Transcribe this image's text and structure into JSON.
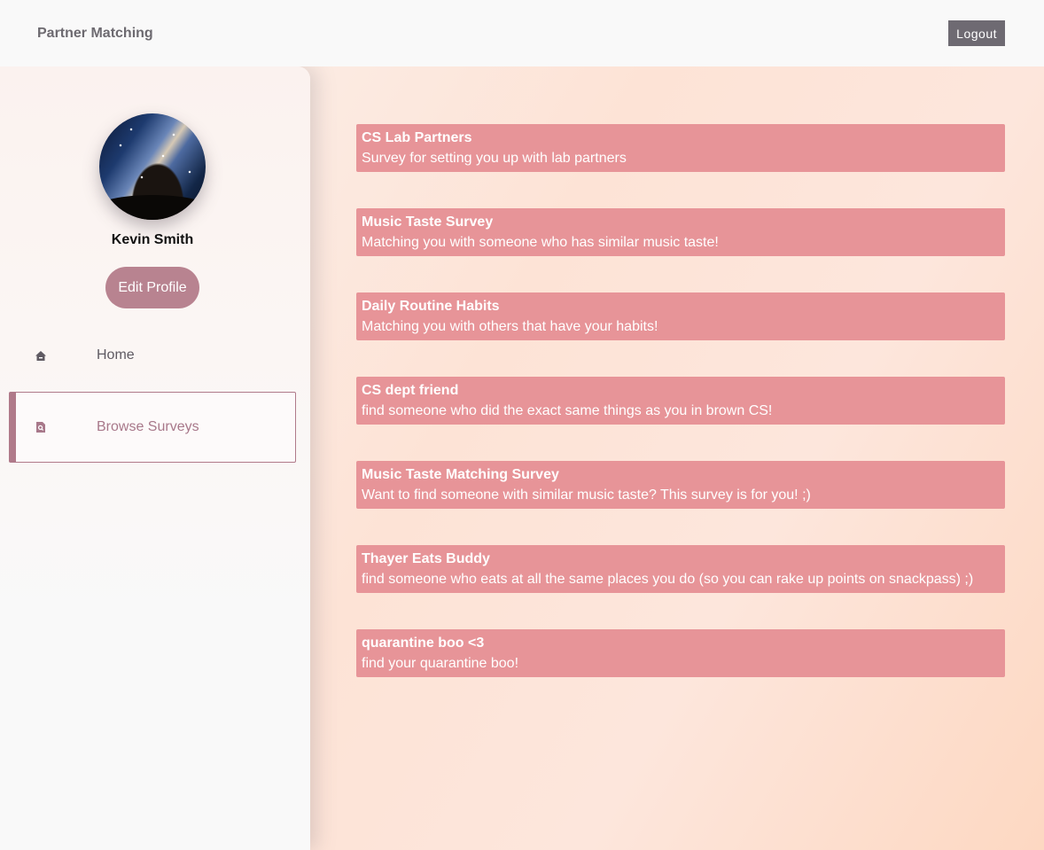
{
  "navbar": {
    "brand": "Partner Matching",
    "logout_label": "Logout"
  },
  "sidebar": {
    "user_name": "Kevin Smith",
    "edit_profile_label": "Edit Profile",
    "items": [
      {
        "label": "Home",
        "icon": "home-icon",
        "active": false
      },
      {
        "label": "Browse Surveys",
        "icon": "search-document-icon",
        "active": true
      }
    ]
  },
  "surveys": [
    {
      "title": "CS Lab Partners",
      "description": "Survey for setting you up with lab partners"
    },
    {
      "title": "Music Taste Survey",
      "description": "Matching you with someone who has similar music taste!"
    },
    {
      "title": "Daily Routine Habits",
      "description": "Matching you with others that have your habits!"
    },
    {
      "title": "CS dept friend",
      "description": "find someone who did the exact same things as you in brown CS!"
    },
    {
      "title": "Music Taste Matching Survey",
      "description": "Want to find someone with similar music taste? This survey is for you! ;)"
    },
    {
      "title": "Thayer Eats Buddy",
      "description": "find someone who eats at all the same places you do (so you can rake up points on snackpass) ;)"
    },
    {
      "title": "quarantine boo <3",
      "description": "find your quarantine boo!"
    }
  ],
  "colors": {
    "accent": "#b88390",
    "card": "#e79498",
    "logout_bg": "#6e6a72"
  }
}
